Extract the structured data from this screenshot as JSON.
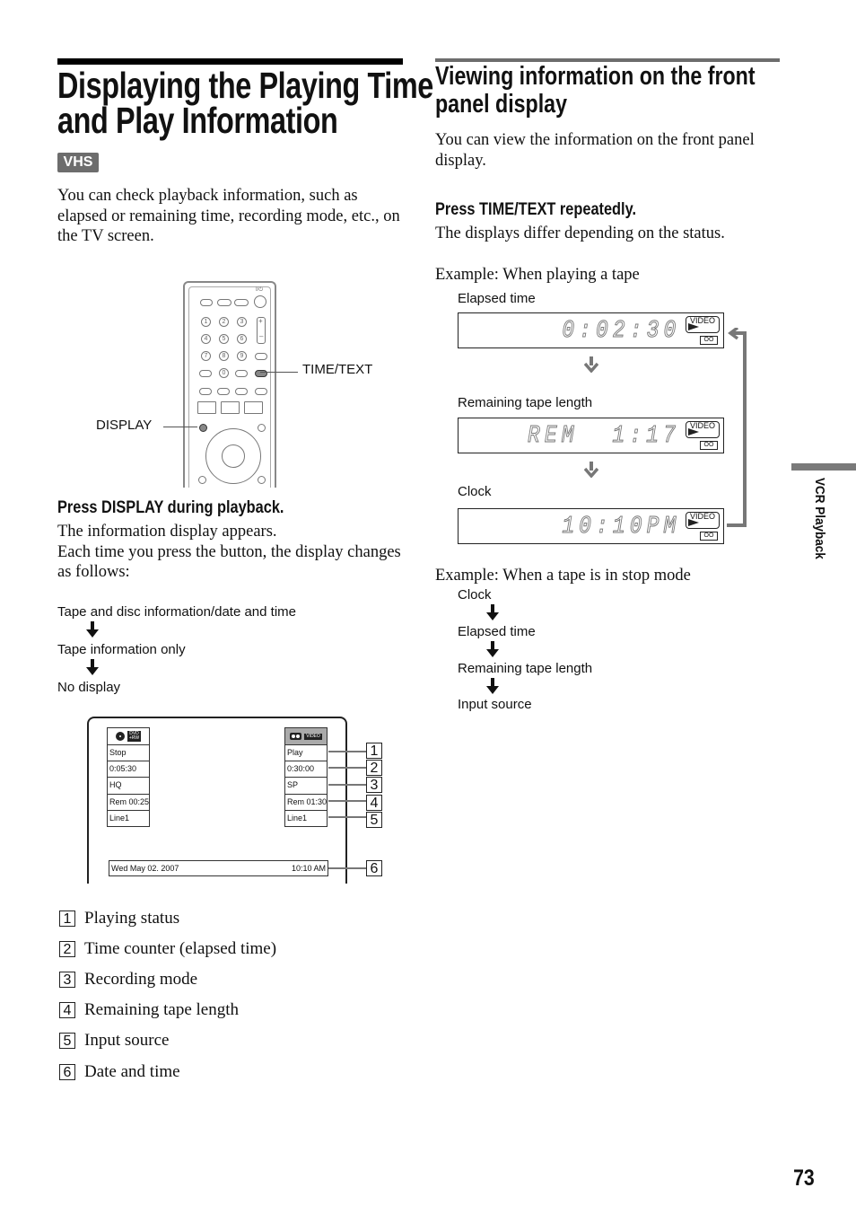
{
  "left": {
    "title_line1": "Displaying the Playing Time",
    "title_line2": "and Play Information",
    "badge": "VHS",
    "intro": "You can check playback information, such as elapsed or remaining time, recording mode, etc., on the TV screen.",
    "remote": {
      "power_label": "I/⏻",
      "numbers": [
        "1",
        "2",
        "3",
        "4",
        "5",
        "6",
        "7",
        "8",
        "9",
        "0"
      ],
      "volume_plus": "+",
      "volume_minus": "–",
      "time_text_label": "TIME/TEXT",
      "display_label": "DISPLAY"
    },
    "step_title": "Press DISPLAY during playback.",
    "step_body_line1": "The information display appears.",
    "step_body_line2": "Each time you press the button, the display changes as follows:",
    "display_cycle": [
      "Tape and disc information/date and time",
      "Tape information only",
      "No display"
    ],
    "osd": {
      "dvd": {
        "badge": "DVD\n+RW",
        "rows": [
          "Stop",
          "0:05:30",
          "HQ",
          "Rem 00:25",
          "Line1"
        ]
      },
      "vcr": {
        "badge": "VIDEO",
        "rows": [
          "Play",
          "0:30:00",
          "SP",
          "Rem 01:30",
          "Line1"
        ]
      },
      "date": "Wed May 02. 2007",
      "time": "10:10 AM",
      "callouts": [
        "1",
        "2",
        "3",
        "4",
        "5",
        "6"
      ]
    },
    "legend": [
      {
        "num": "1",
        "text": "Playing status"
      },
      {
        "num": "2",
        "text": "Time counter (elapsed time)"
      },
      {
        "num": "3",
        "text": "Recording mode"
      },
      {
        "num": "4",
        "text": "Remaining tape length"
      },
      {
        "num": "5",
        "text": "Input source"
      },
      {
        "num": "6",
        "text": "Date and time"
      }
    ]
  },
  "right": {
    "title_line1": "Viewing information on the front",
    "title_line2": "panel display",
    "intro": "You can view the information on the front panel display.",
    "step_title": "Press TIME/TEXT repeatedly.",
    "step_body": "The displays differ depending on the status.",
    "example_playing": "Example: When playing a tape",
    "panels": [
      {
        "label": "Elapsed time",
        "lcd": "0:02:30"
      },
      {
        "label": "Remaining tape length",
        "lcd": "REM  1:17"
      },
      {
        "label": "Clock",
        "lcd": "10:10PM"
      }
    ],
    "panel_badge": "VIDEO",
    "panel_tape": "OO",
    "example_stop": "Example: When a tape is in stop mode",
    "stop_cycle": [
      "Clock",
      "Elapsed time",
      "Remaining tape length",
      "Input source"
    ]
  },
  "side_tab": "VCR Playback",
  "page_number": "73"
}
